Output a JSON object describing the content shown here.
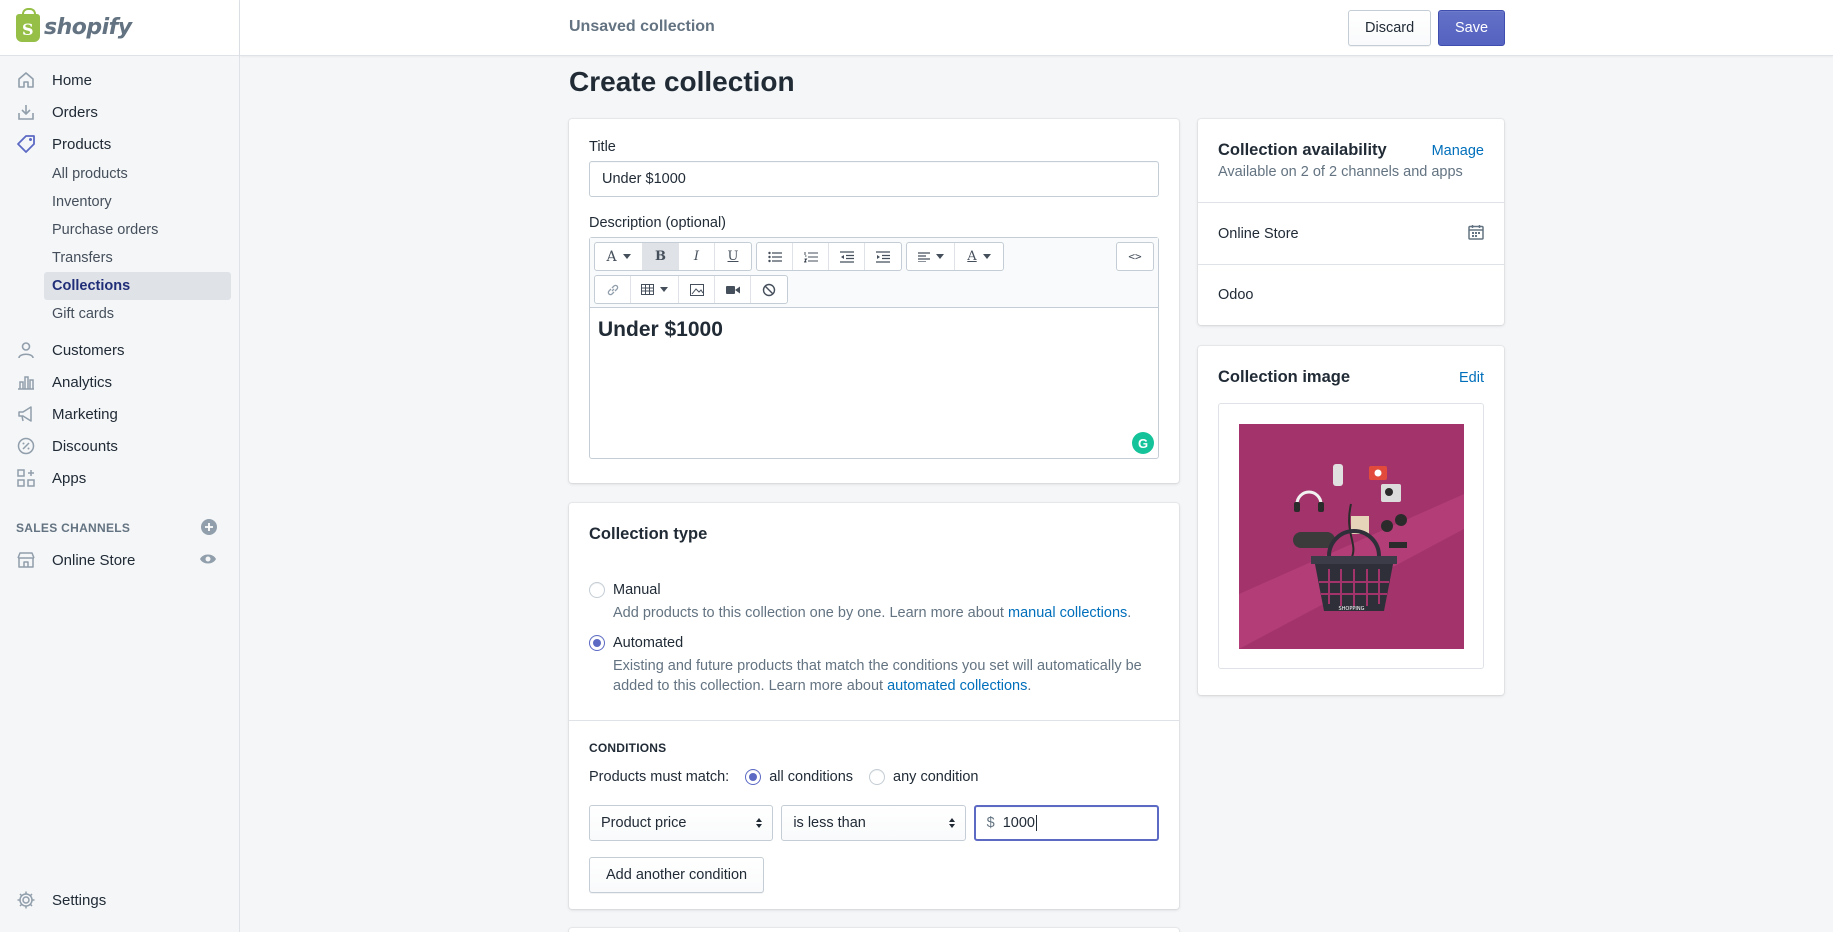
{
  "brand": {
    "name": "shopify"
  },
  "sidebar": {
    "items": [
      {
        "label": "Home",
        "icon": "home-icon"
      },
      {
        "label": "Orders",
        "icon": "orders-icon"
      },
      {
        "label": "Products",
        "icon": "tag-icon"
      }
    ],
    "product_sub": [
      "All products",
      "Inventory",
      "Purchase orders",
      "Transfers",
      "Collections",
      "Gift cards"
    ],
    "items2": [
      {
        "label": "Customers",
        "icon": "person-icon"
      },
      {
        "label": "Analytics",
        "icon": "bar-chart-icon"
      },
      {
        "label": "Marketing",
        "icon": "megaphone-icon"
      },
      {
        "label": "Discounts",
        "icon": "discount-icon"
      },
      {
        "label": "Apps",
        "icon": "apps-icon"
      }
    ],
    "sales_channels_label": "SALES CHANNELS",
    "online_store": "Online Store",
    "settings": "Settings"
  },
  "topbar": {
    "status": "Unsaved collection",
    "discard": "Discard",
    "save": "Save"
  },
  "page": {
    "title": "Create collection"
  },
  "form": {
    "title_label": "Title",
    "title_value": "Under $1000",
    "description_label": "Description (optional)",
    "description_content": "Under $1000",
    "grammarly": "G"
  },
  "collection_type": {
    "heading": "Collection type",
    "manual_label": "Manual",
    "manual_help": "Add products to this collection one by one. Learn more about ",
    "manual_link": "manual collections",
    "automated_label": "Automated",
    "automated_help_1": "Existing and future products that match the conditions you set will automatically be",
    "automated_help_2": "added to this collection. Learn more about ",
    "automated_link": "automated collections",
    "period": "."
  },
  "conditions": {
    "heading": "CONDITIONS",
    "match_label": "Products must match:",
    "all_conditions": "all conditions",
    "any_condition": "any condition",
    "field": "Product price",
    "operator": "is less than",
    "currency": "$",
    "value": "1000",
    "add_button": "Add another condition"
  },
  "availability": {
    "heading": "Collection availability",
    "manage": "Manage",
    "summary": "Available on 2 of 2 channels and apps",
    "channels": [
      "Online Store",
      "Odoo"
    ]
  },
  "image_card": {
    "heading": "Collection image",
    "edit": "Edit",
    "caption": "SHOPPING",
    "bg_color": "#a3336b"
  },
  "colors": {
    "accent": "#5c6ac4",
    "link": "#006fbb",
    "selected_bg": "#dfe3e8"
  }
}
